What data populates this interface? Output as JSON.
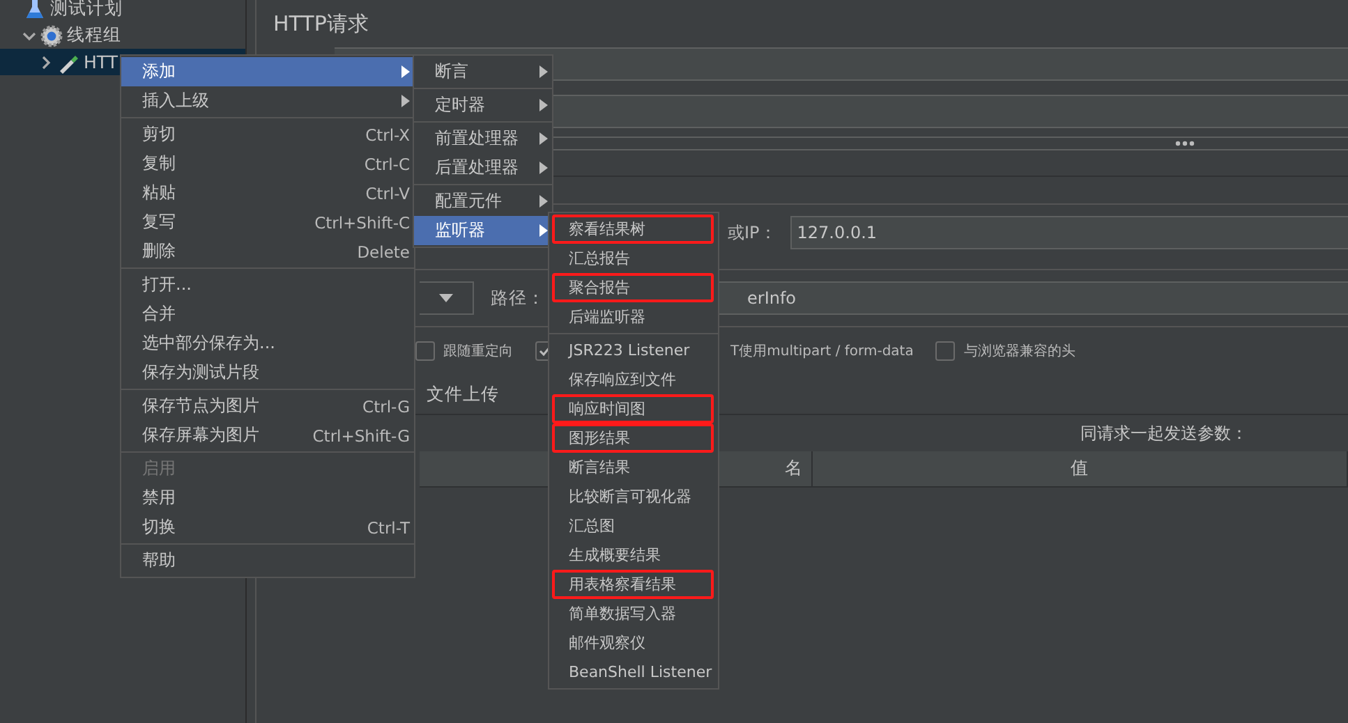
{
  "tree": [
    {
      "label": "测试计划",
      "selected": false,
      "children": [
        {
          "label": "线程组",
          "selected": false,
          "expanded": true,
          "children": [
            {
              "label": "HTT",
              "selected": true,
              "expanded": false
            }
          ]
        }
      ]
    }
  ],
  "panel": {
    "title": "HTTP请求",
    "host_label": "或IP：",
    "host_value": "127.0.0.1",
    "path_label": "路径：",
    "path_value": "erInfo",
    "options": [
      {
        "checked": false,
        "label": "跟随重定向"
      },
      {
        "checked": true
      },
      {
        "label": "T使用multipart / form-data"
      },
      {
        "checked": false,
        "label": "与浏览器兼容的头"
      }
    ],
    "tab_label": "文件上传",
    "params_caption": "同请求一起发送参数：",
    "columns": [
      "名",
      "值"
    ]
  },
  "context_menu": [
    {
      "kind": "item",
      "label": "添加",
      "has_submenu": true,
      "highlighted": true,
      "disabled": false
    },
    {
      "kind": "item",
      "label": "插入上级",
      "has_submenu": true,
      "highlighted": false,
      "disabled": false
    },
    {
      "kind": "separator"
    },
    {
      "kind": "item",
      "label": "剪切",
      "shortcut": "Ctrl-X",
      "has_submenu": false,
      "highlighted": false,
      "disabled": false
    },
    {
      "kind": "item",
      "label": "复制",
      "shortcut": "Ctrl-C",
      "has_submenu": false,
      "highlighted": false,
      "disabled": false
    },
    {
      "kind": "item",
      "label": "粘贴",
      "shortcut": "Ctrl-V",
      "has_submenu": false,
      "highlighted": false,
      "disabled": false
    },
    {
      "kind": "item",
      "label": "复写",
      "shortcut": "Ctrl+Shift-C",
      "has_submenu": false,
      "highlighted": false,
      "disabled": false
    },
    {
      "kind": "item",
      "label": "删除",
      "shortcut": "Delete",
      "has_submenu": false,
      "highlighted": false,
      "disabled": false
    },
    {
      "kind": "separator"
    },
    {
      "kind": "item",
      "label": "打开...",
      "has_submenu": false,
      "highlighted": false,
      "disabled": false
    },
    {
      "kind": "item",
      "label": "合并",
      "has_submenu": false,
      "highlighted": false,
      "disabled": false
    },
    {
      "kind": "item",
      "label": "选中部分保存为...",
      "has_submenu": false,
      "highlighted": false,
      "disabled": false
    },
    {
      "kind": "item",
      "label": "保存为测试片段",
      "has_submenu": false,
      "highlighted": false,
      "disabled": false
    },
    {
      "kind": "separator"
    },
    {
      "kind": "item",
      "label": "保存节点为图片",
      "shortcut": "Ctrl-G",
      "has_submenu": false,
      "highlighted": false,
      "disabled": false
    },
    {
      "kind": "item",
      "label": "保存屏幕为图片",
      "shortcut": "Ctrl+Shift-G",
      "has_submenu": false,
      "highlighted": false,
      "disabled": false
    },
    {
      "kind": "separator"
    },
    {
      "kind": "item",
      "label": "启用",
      "has_submenu": false,
      "highlighted": false,
      "disabled": true
    },
    {
      "kind": "item",
      "label": "禁用",
      "has_submenu": false,
      "highlighted": false,
      "disabled": false
    },
    {
      "kind": "item",
      "label": "切换",
      "shortcut": "Ctrl-T",
      "has_submenu": false,
      "highlighted": false,
      "disabled": false
    },
    {
      "kind": "separator"
    },
    {
      "kind": "item",
      "label": "帮助",
      "has_submenu": false,
      "highlighted": false,
      "disabled": false
    }
  ],
  "add_submenu": [
    {
      "kind": "item",
      "label": "断言",
      "has_submenu": true,
      "highlighted": false
    },
    {
      "kind": "separator"
    },
    {
      "kind": "item",
      "label": "定时器",
      "has_submenu": true,
      "highlighted": false
    },
    {
      "kind": "separator"
    },
    {
      "kind": "item",
      "label": "前置处理器",
      "has_submenu": true,
      "highlighted": false
    },
    {
      "kind": "item",
      "label": "后置处理器",
      "has_submenu": true,
      "highlighted": false
    },
    {
      "kind": "separator"
    },
    {
      "kind": "item",
      "label": "配置元件",
      "has_submenu": true,
      "highlighted": false
    },
    {
      "kind": "item",
      "label": "监听器",
      "has_submenu": true,
      "highlighted": true
    }
  ],
  "listener_submenu": [
    {
      "kind": "item",
      "label": "察看结果树",
      "marked": true
    },
    {
      "kind": "item",
      "label": "汇总报告",
      "marked": false
    },
    {
      "kind": "item",
      "label": "聚合报告",
      "marked": true
    },
    {
      "kind": "item",
      "label": "后端监听器",
      "marked": false
    },
    {
      "kind": "separator"
    },
    {
      "kind": "item",
      "label": "JSR223 Listener",
      "marked": false
    },
    {
      "kind": "item",
      "label": "保存响应到文件",
      "marked": false
    },
    {
      "kind": "item",
      "label": "响应时间图",
      "marked": true
    },
    {
      "kind": "item",
      "label": "图形结果",
      "marked": true
    },
    {
      "kind": "item",
      "label": "断言结果",
      "marked": false
    },
    {
      "kind": "item",
      "label": "比较断言可视化器",
      "marked": false
    },
    {
      "kind": "item",
      "label": "汇总图",
      "marked": false
    },
    {
      "kind": "item",
      "label": "生成概要结果",
      "marked": false
    },
    {
      "kind": "item",
      "label": "用表格察看结果",
      "marked": true
    },
    {
      "kind": "item",
      "label": "简单数据写入器",
      "marked": false
    },
    {
      "kind": "item",
      "label": "邮件观察仪",
      "marked": false
    },
    {
      "kind": "item",
      "label": "BeanShell Listener",
      "marked": false
    }
  ]
}
